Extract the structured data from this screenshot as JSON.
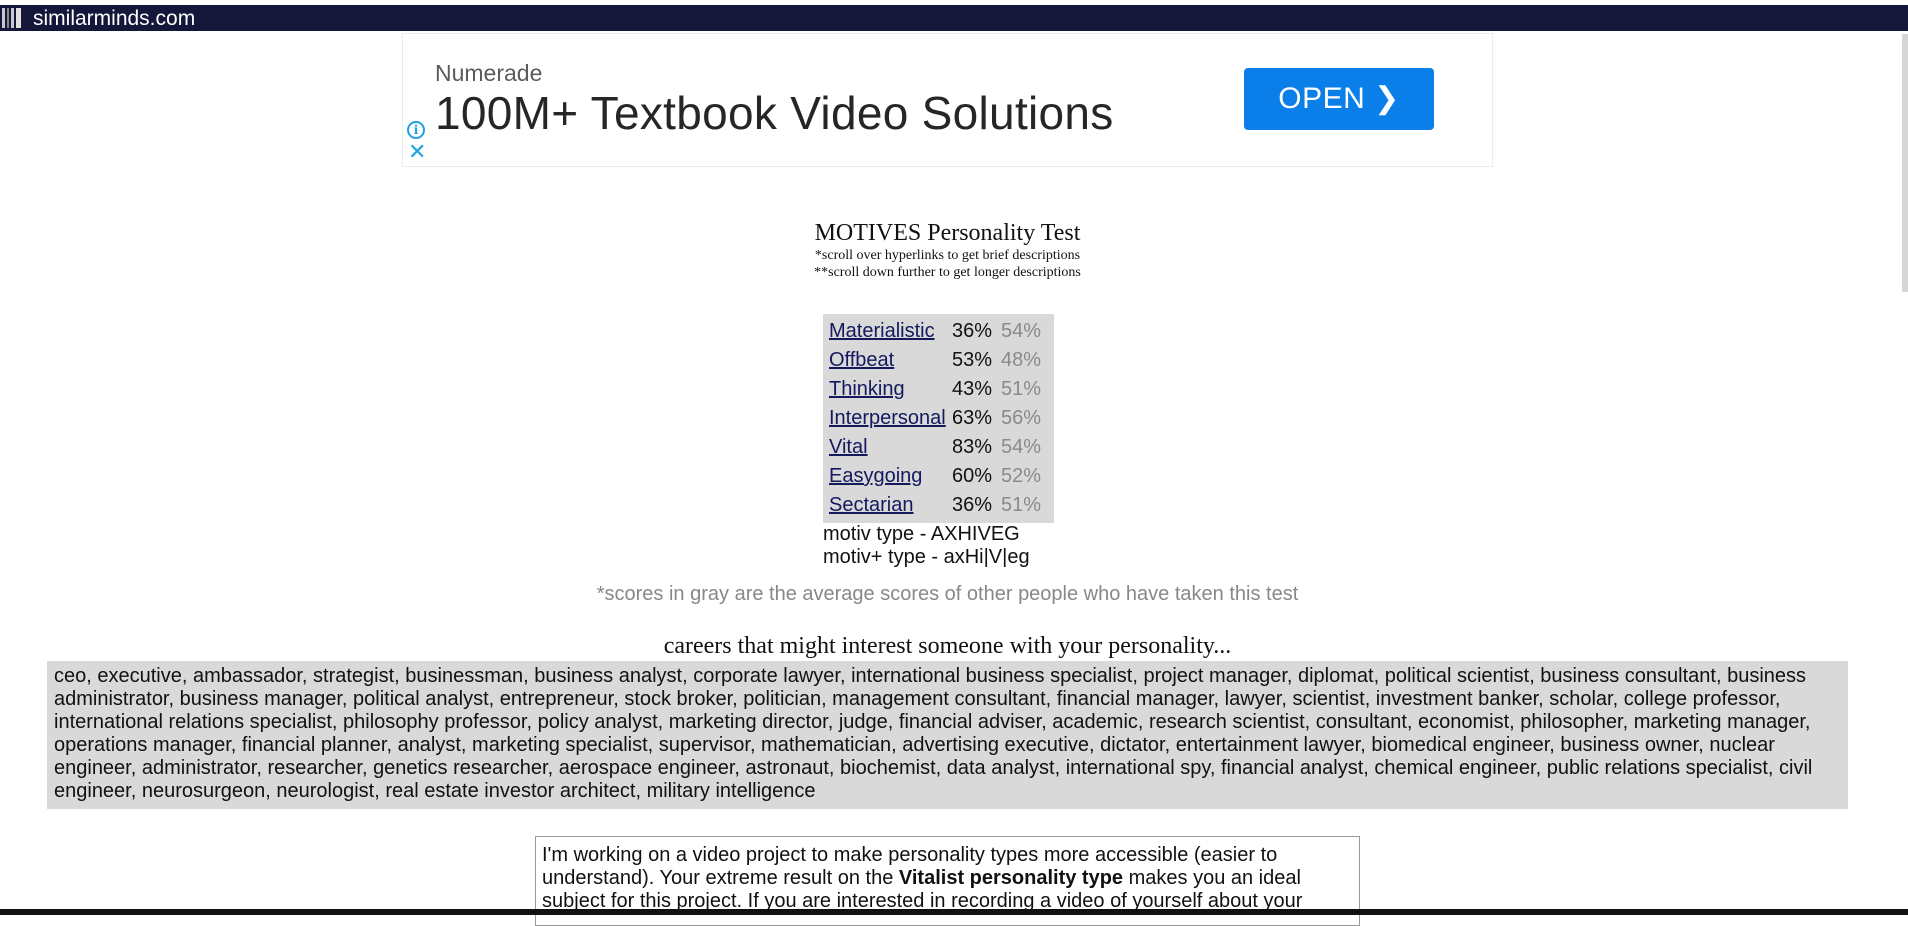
{
  "site": {
    "name": "similarminds.com"
  },
  "ad": {
    "brand": "Numerade",
    "headline": "100M+ Textbook Video Solutions",
    "button_label": "OPEN",
    "button_icon": "chevron-right-icon",
    "info_icon": "info-icon",
    "close_icon": "close-icon",
    "accent": "#0a7fe9"
  },
  "test": {
    "title": "MOTIVES Personality Test",
    "note1": "*scroll over hyperlinks to get brief descriptions",
    "note2": "**scroll down further to get longer descriptions"
  },
  "scores": [
    {
      "name": "Materialistic",
      "you": "36%",
      "avg": "54%"
    },
    {
      "name": "Offbeat",
      "you": "53%",
      "avg": "48%"
    },
    {
      "name": "Thinking",
      "you": "43%",
      "avg": "51%"
    },
    {
      "name": "Interpersonal",
      "you": "63%",
      "avg": "56%"
    },
    {
      "name": "Vital",
      "you": "83%",
      "avg": "54%"
    },
    {
      "name": "Easygoing",
      "you": "60%",
      "avg": "52%"
    },
    {
      "name": "Sectarian",
      "you": "36%",
      "avg": "51%"
    }
  ],
  "motiv_type": "motiv type - AXHIVEG",
  "motiv_plus_type": "motiv+ type - axHi|V|eg",
  "gray_note": "*scores in gray are the average scores of other people who have taken this test",
  "careers_title": "careers that might interest someone with your personality...",
  "careers_text": "ceo, executive, ambassador, strategist, businessman, business analyst, corporate lawyer, international business specialist, project manager, diplomat, political scientist, business consultant, business administrator, business manager, political analyst, entrepreneur, stock broker, politician, management consultant, financial manager, lawyer, scientist, investment banker, scholar, college professor, international relations specialist, philosophy professor, policy analyst, marketing director, judge, financial adviser, academic, research scientist, consultant, economist, philosopher, marketing manager, operations manager, financial planner, analyst, marketing specialist, supervisor, mathematician, advertising executive, dictator, entertainment lawyer, biomedical engineer, business owner, nuclear engineer, administrator, researcher, genetics researcher, aerospace engineer, astronaut, biochemist, data analyst, international spy, financial analyst, chemical engineer, public relations specialist, civil engineer, neurosurgeon, neurologist, real estate investor architect, military intelligence",
  "video": {
    "part1": "I'm working on a video project to make personality types more accessible (easier to understand). Your extreme result on the ",
    "bold": "Vitalist personality type",
    "part2": " makes you an ideal subject for this project. If you are interested in recording a video of yourself about your"
  }
}
